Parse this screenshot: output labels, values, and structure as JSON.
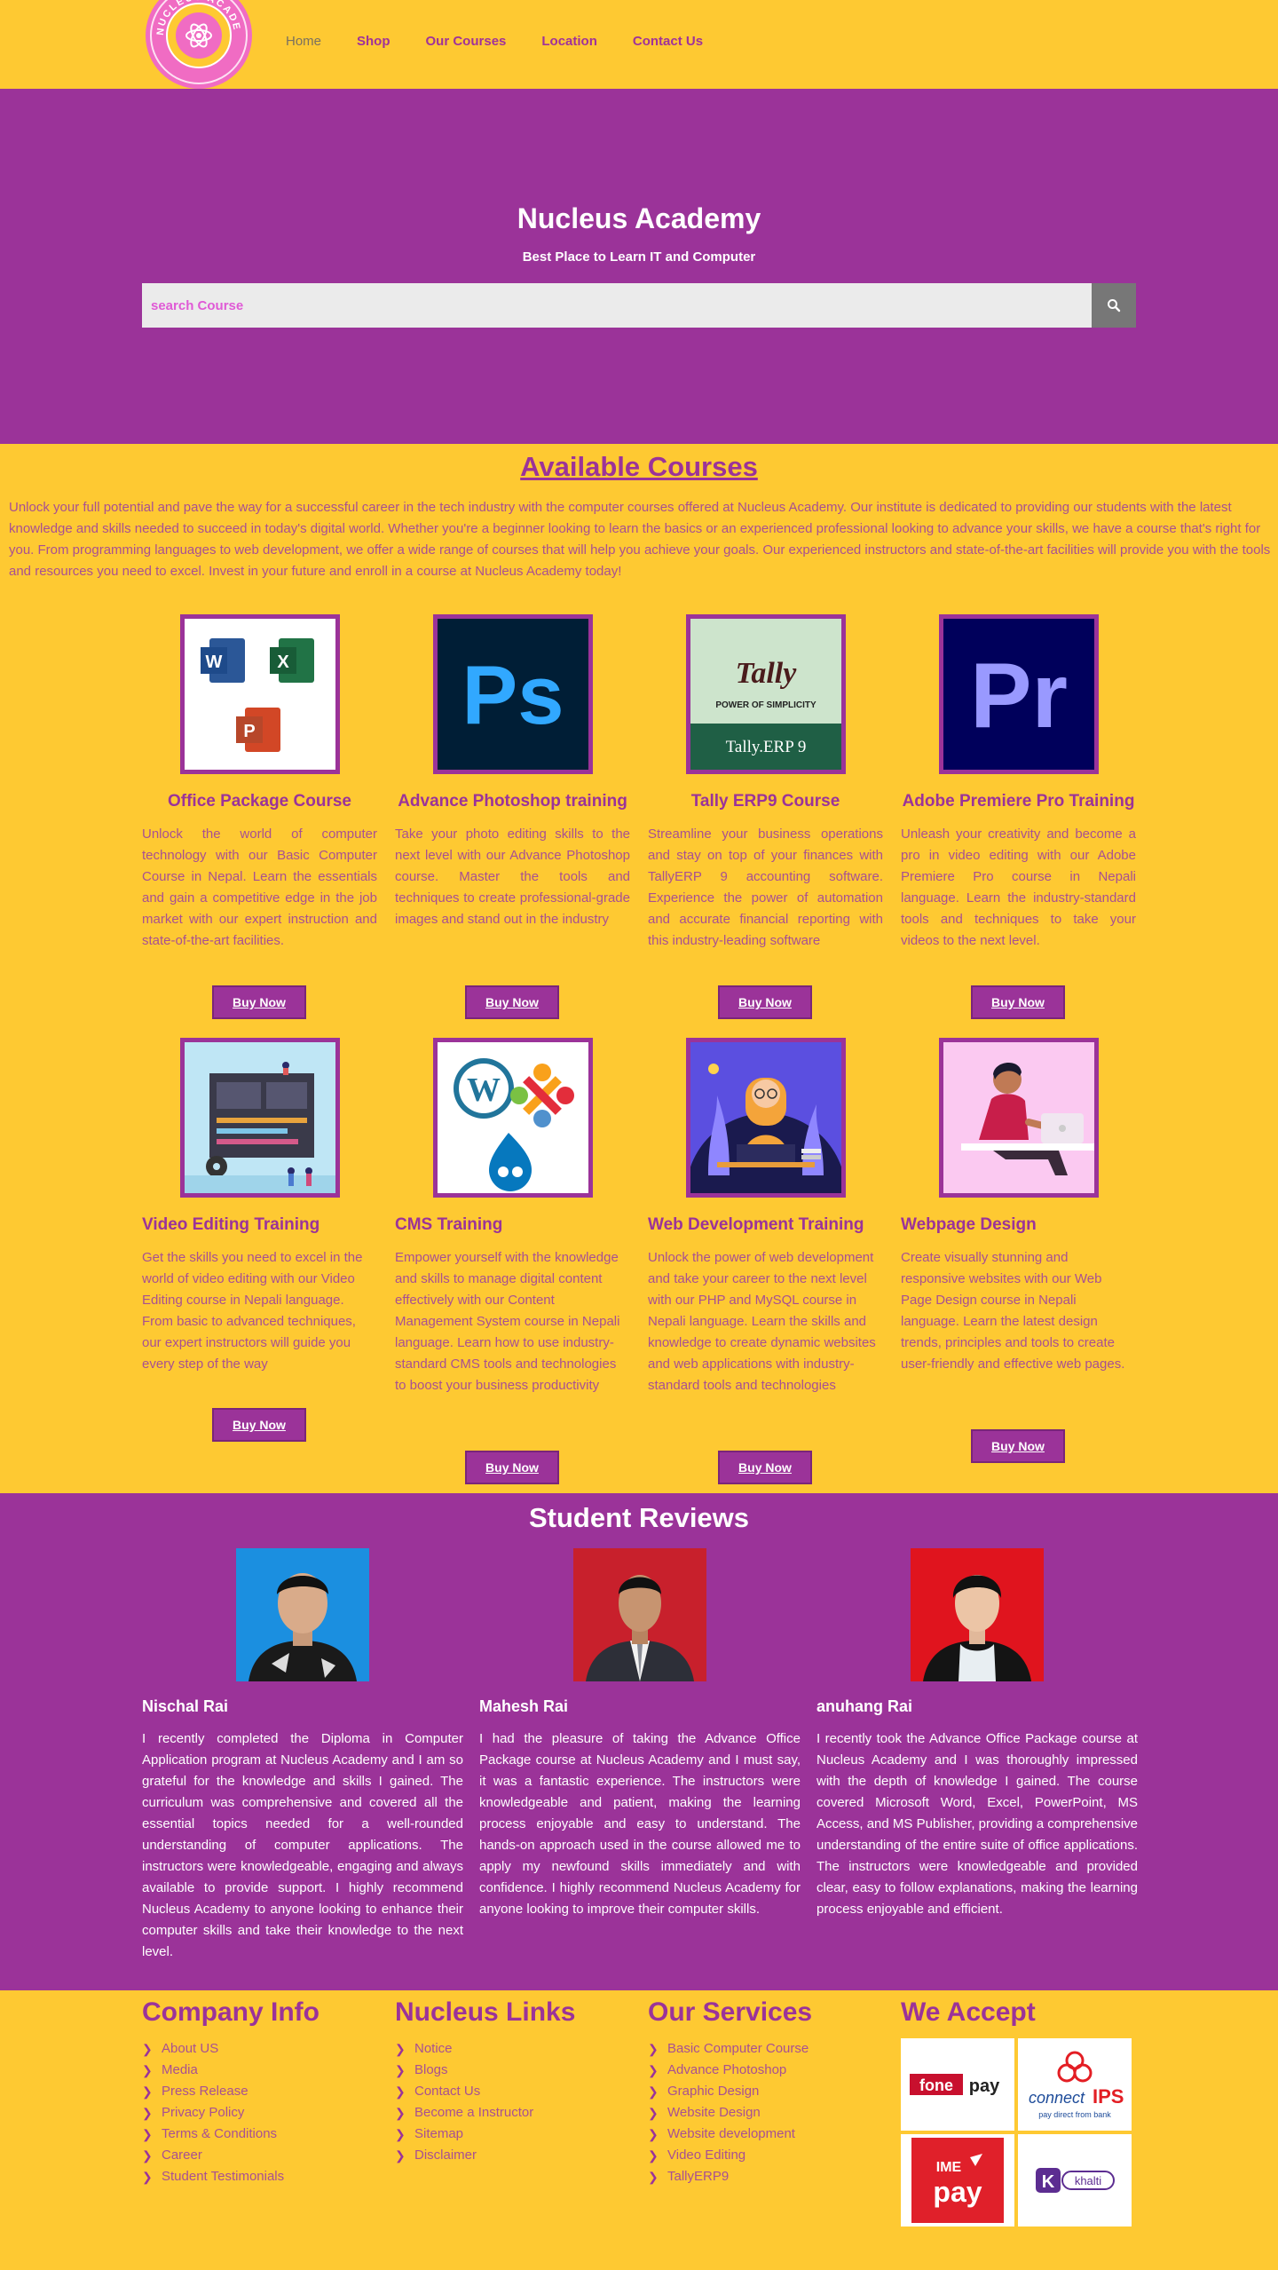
{
  "header": {
    "logo_alt": "NUCLEUS ACADEMY",
    "nav": [
      "Home",
      "Shop",
      "Our Courses",
      "Location",
      "Contact Us"
    ]
  },
  "hero": {
    "title": "Nucleus Academy",
    "subtitle": "Best Place to Learn IT and Computer",
    "search_placeholder": "search Course",
    "search_icon": "search-icon"
  },
  "courses": {
    "title": "Available Courses",
    "intro": "Unlock your full potential and pave the way for a successful career in the tech industry with the computer courses offered at Nucleus Academy. Our institute is dedicated to providing our students with the latest knowledge and skills needed to succeed in today's digital world. Whether you're a beginner looking to learn the basics or an experienced professional looking to advance your skills, we have a course that's right for you. From programming languages to web development, we offer a wide range of courses that will help you achieve your goals. Our experienced instructors and state-of-the-art facilities will provide you with the tools and resources you need to excel. Invest in your future and enroll in a course at Nucleus Academy today!",
    "buy_label": "Buy Now",
    "items": [
      {
        "name": "Office Package Course",
        "desc": "Unlock the world of computer technology with our Basic Computer Course in Nepal. Learn the essentials and gain a competitive edge in the job market with our expert instruction and state-of-the-art facilities."
      },
      {
        "name": "Advance Photoshop training",
        "desc": "Take your photo editing skills to the next level with our Advance Photoshop course. Master the tools and techniques to create professional-grade images and stand out in the industry"
      },
      {
        "name": "Tally ERP9 Course",
        "desc": "Streamline your business operations and stay on top of your finances with TallyERP 9 accounting software. Experience the power of automation and accurate financial reporting with this industry-leading software"
      },
      {
        "name": "Adobe Premiere Pro Training",
        "desc": "Unleash your creativity and become a pro in video editing with our Adobe Premiere Pro course in Nepali language. Learn the industry-standard tools and techniques to take your videos to the next level."
      },
      {
        "name": "Video Editing Training",
        "desc": "Get the skills you need to excel in the world of video editing with our Video Editing course in Nepali language. From basic to advanced techniques, our expert instructors will guide you every step of the way"
      },
      {
        "name": "CMS Training",
        "desc": "Empower yourself with the knowledge and skills to manage digital content effectively with our Content Management System course in Nepali language. Learn how to use industry-standard CMS tools and technologies to boost your business productivity"
      },
      {
        "name": "Web Development Training",
        "desc": "Unlock the power of web development and take your career to the next level with our PHP and MySQL course in Nepali language. Learn the skills and knowledge to create dynamic websites and web applications with industry-standard tools and technologies"
      },
      {
        "name": "Webpage Design",
        "desc": "Create visually stunning and responsive websites with our Web Page Design course in Nepali language. Learn the latest design trends, principles and tools to create user-friendly and effective web pages."
      }
    ],
    "tally_logo": "Tally",
    "tally_tagline": "POWER OF SIMPLICITY",
    "tally_product": "Tally.ERP 9",
    "ps_label": "Ps",
    "pr_label": "Pr"
  },
  "reviews": {
    "title": "Student Reviews",
    "items": [
      {
        "name": "Nischal Rai",
        "text": "I recently completed the Diploma in Computer Application program at Nucleus Academy and I am so grateful for the knowledge and skills I gained. The curriculum was comprehensive and covered all the essential topics needed for a well-rounded understanding of computer applications. The instructors were knowledgeable, engaging and always available to provide support. I highly recommend Nucleus Academy to anyone looking to enhance their computer skills and take their knowledge to the next level."
      },
      {
        "name": "Mahesh Rai",
        "text": "I had the pleasure of taking the Advance Office Package course at Nucleus Academy and I must say, it was a fantastic experience. The instructors were knowledgeable and patient, making the learning process enjoyable and easy to understand. The hands-on approach used in the course allowed me to apply my newfound skills immediately and with confidence. I highly recommend Nucleus Academy for anyone looking to improve their computer skills."
      },
      {
        "name": "anuhang Rai",
        "text": "I recently took the Advance Office Package course at Nucleus Academy and I was thoroughly impressed with the depth of knowledge I gained. The course covered Microsoft Word, Excel, PowerPoint, MS Access, and MS Publisher, providing a comprehensive understanding of the entire suite of office applications. The instructors were knowledgeable and provided clear, easy to follow explanations, making the learning process enjoyable and efficient."
      }
    ]
  },
  "footer": {
    "company": {
      "title": "Company Info",
      "links": [
        "About US",
        "Media",
        "Press Release",
        "Privacy Policy",
        "Terms & Conditions",
        "Career",
        "Student Testimonials"
      ]
    },
    "links": {
      "title": "Nucleus Links",
      "links": [
        "Notice",
        "Blogs",
        "Contact Us",
        "Become a Instructor",
        "Sitemap",
        "Disclaimer"
      ]
    },
    "services": {
      "title": "Our Services",
      "links": [
        "Basic Computer Course",
        "Advance Photoshop",
        "Graphic Design",
        "Website Design",
        "Website development",
        "Video Editing",
        "TallyERP9"
      ]
    },
    "accept": {
      "title": "We Accept",
      "methods": [
        "fonepay",
        "connectIPS",
        "IME pay",
        "khalti"
      ],
      "connect_tagline": "pay direct from bank"
    }
  },
  "colors": {
    "brand_purple": "#9b3399",
    "brand_yellow": "#fec932"
  }
}
